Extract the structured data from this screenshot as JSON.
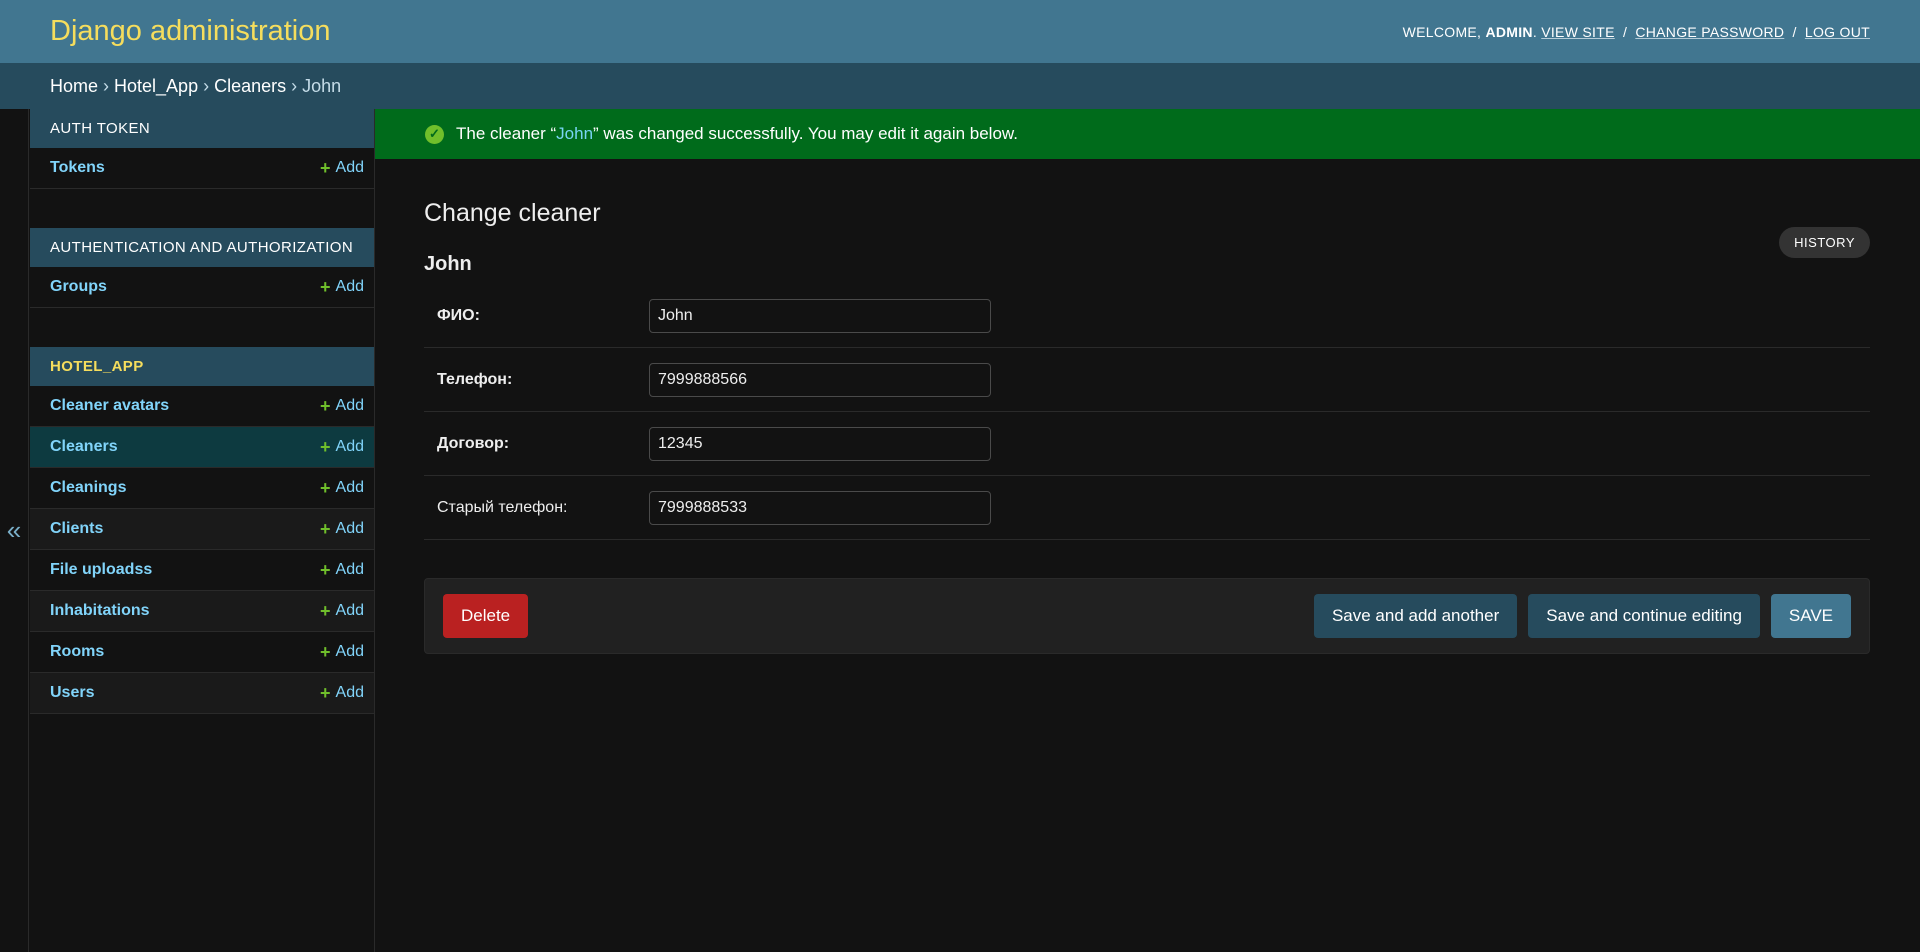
{
  "header": {
    "brand": "Django administration",
    "welcome_prefix": "WELCOME, ",
    "username": "ADMIN",
    "period": ".",
    "view_site": "VIEW SITE",
    "change_password": "CHANGE PASSWORD",
    "log_out": "LOG OUT",
    "separator": "/"
  },
  "breadcrumbs": {
    "home": "Home",
    "app": "Hotel_App",
    "model": "Cleaners",
    "current": "John",
    "arrow": "›"
  },
  "sidebar_toggle": "«",
  "sidebar": {
    "add_label": "Add",
    "plus": "+",
    "modules": [
      {
        "caption": "Auth Token",
        "items": [
          {
            "name": "Tokens"
          }
        ]
      },
      {
        "caption": "Authentication and Authorization",
        "items": [
          {
            "name": "Groups"
          }
        ]
      },
      {
        "caption": "Hotel_App",
        "items": [
          {
            "name": "Cleaner avatars"
          },
          {
            "name": "Cleaners"
          },
          {
            "name": "Cleanings"
          },
          {
            "name": "Clients"
          },
          {
            "name": "File uploadss"
          },
          {
            "name": "Inhabitations"
          },
          {
            "name": "Rooms"
          },
          {
            "name": "Users"
          }
        ]
      }
    ]
  },
  "message": {
    "prefix": "The cleaner “",
    "object": "John",
    "suffix": "” was changed successfully. You may edit it again below."
  },
  "page": {
    "title": "Change cleaner",
    "object_title": "John",
    "history": "History"
  },
  "form": {
    "fields": [
      {
        "label": "ФИО:",
        "value": "John"
      },
      {
        "label": "Телефон:",
        "value": "7999888566"
      },
      {
        "label": "Договор:",
        "value": "12345"
      },
      {
        "label": "Старый телефон:",
        "value": "7999888533"
      }
    ]
  },
  "actions": {
    "delete": "Delete",
    "save_add_another": "Save and add another",
    "save_continue": "Save and continue editing",
    "save": "Save"
  },
  "colors": {
    "header_bg": "#417690",
    "brand": "#f5dd5d",
    "breadcrumbs_bg": "#264b5d",
    "success_bg": "#006b1b",
    "delete_bg": "#ba2121",
    "link": "#81d4fa",
    "add_plus": "#70bf2b"
  }
}
